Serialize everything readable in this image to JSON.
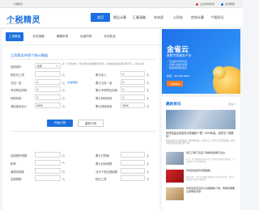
{
  "topbar": {
    "left_text": "个税精灵",
    "links": [
      "企业律师顾问",
      "在线帮助"
    ]
  },
  "header": {
    "logo": "个税精灵",
    "logo_sub": "gesuijingling.com",
    "nav": [
      {
        "label": "首页",
        "active": true
      },
      {
        "label": "税后计算",
        "active": false
      },
      {
        "label": "汇算清缴",
        "active": false
      },
      {
        "label": "年终奖",
        "active": false
      },
      {
        "label": "公积金",
        "active": false
      },
      {
        "label": "房贷计算",
        "active": false
      },
      {
        "label": "个税资讯",
        "active": false
      }
    ]
  },
  "tabs": [
    {
      "label": "工资薪金",
      "active": true
    },
    {
      "label": "劳务报酬",
      "active": false
    },
    {
      "label": "稿酬所得",
      "active": false
    },
    {
      "label": "经营所得",
      "active": false
    },
    {
      "label": "年终奖金",
      "active": false
    }
  ],
  "form": {
    "title": "工资薪金所得个税计算器",
    "rows": [
      {
        "left_label": "选择城市",
        "left_value": "北京",
        "note": "选一下所在城市，部分城市社保缴费比例不同，各地社保基数可能有所不同，以实际为准"
      },
      {
        "left_label": "税前月工资",
        "left_value": "",
        "left_unit": "元",
        "right_label": "累计收入",
        "right_value": "0",
        "right_unit": "元"
      },
      {
        "left_label": "五险一金",
        "left_value": "0",
        "left_unit": "元",
        "left_note": "[查看明细]",
        "right_label": "累计五险一金",
        "right_value": "0",
        "right_unit": "元"
      },
      {
        "left_label": "专项附加扣除",
        "left_value": "0",
        "left_unit": "元",
        "right_label": "累计专项附加扣除",
        "right_value": "0",
        "right_unit": "元"
      },
      {
        "left_label": "其他扣除",
        "left_value": "0",
        "left_unit": "元",
        "right_label": "累计其他扣除",
        "right_value": "0",
        "right_unit": "元"
      },
      {
        "left_label": "减除费用合计",
        "left_value": "5000",
        "left_unit": "元",
        "right_label": "累计减除费用",
        "right_value": "5000",
        "right_unit": "元"
      }
    ],
    "buttons": {
      "calculate": "开始计算",
      "reset": "重新计算"
    }
  },
  "results": {
    "rows": [
      {
        "left_label": "应纳税所得额",
        "left_unit": "元",
        "right_label": "累计已预缴",
        "right_unit": "元"
      },
      {
        "left_label": "税率",
        "left_unit": "%",
        "right_label": "累计应纳税额",
        "right_unit": "元"
      },
      {
        "left_label": "速算扣除数",
        "left_unit": "元",
        "right_label": "当月个税应缴纳额",
        "right_unit": "元"
      },
      {
        "left_label": "应缴税额",
        "left_unit": "元",
        "right_label": "税后工资",
        "right_unit": "元"
      }
    ]
  },
  "sidebar": {
    "banner": {
      "title": "金雀云",
      "subtitle": "财税专家服务平台",
      "items": [
        "专业税务筹划方案",
        "合规企业账务处理",
        "资深财税团队服务"
      ],
      "phone": "热线：400-600-8000",
      "button": "立即咨询"
    },
    "news": {
      "heading": "最新资讯",
      "more": "更多>>",
      "top_title": "年终奖金应该如何计算缴纳个税？2022年起，这样交个税更省！",
      "top_desc": "年终奖是企业给职员的一笔丰厚奖励，也是员工一年辛苦工作的回报，那么年终奖金该如何计算个税？",
      "items": [
        {
          "title": "浙江只能门急医个税税务政策已出台",
          "desc": "近日，浙江省税务局发布关于个税改革的新政策解读，涉及诸多个人所得税优惠。"
        },
        {
          "title": "年终奖金如何合理避税",
          "desc": "临近年底，不少企业都在准备给员工发放年终奖，那么年终奖如何发放才更划算？"
        },
        {
          "title": "年终奖金应当怎么合理缴纳个税，申报时需要注意哪些问题",
          "desc": ""
        }
      ]
    }
  }
}
